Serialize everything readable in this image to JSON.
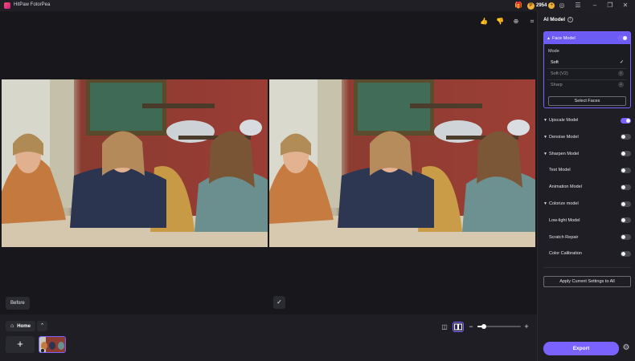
{
  "app": {
    "title": "HitPaw FotorPea"
  },
  "titlebar": {
    "credits": "2954",
    "icons": [
      "gift-icon",
      "coin-icon",
      "plus-icon",
      "user-icon",
      "menu-icon",
      "minimize-icon",
      "restore-icon",
      "close-icon"
    ]
  },
  "canvas": {
    "before_label": "Before",
    "preview_tools": [
      "thumbs-up-icon",
      "thumbs-down-icon",
      "zoom-icon",
      "crop-icon"
    ]
  },
  "bottom": {
    "home_label": "Home",
    "add_symbol": "+",
    "zoom_level": 0.15
  },
  "panel": {
    "title": "AI Model",
    "face_model": {
      "label": "Face Model",
      "enabled": true,
      "mode_label": "Mode",
      "modes": [
        {
          "name": "Soft",
          "selected": true
        },
        {
          "name": "Soft (V2)",
          "selected": false
        },
        {
          "name": "Sharp",
          "selected": false
        }
      ],
      "select_faces_label": "Select Faces"
    },
    "models": [
      {
        "name": "Upscale Model",
        "expandable": true,
        "enabled": true
      },
      {
        "name": "Denoise Model",
        "expandable": true,
        "enabled": false
      },
      {
        "name": "Sharpen Model",
        "expandable": true,
        "enabled": false
      },
      {
        "name": "Text Model",
        "expandable": false,
        "enabled": false
      },
      {
        "name": "Animation Model",
        "expandable": false,
        "enabled": false
      },
      {
        "name": "Colorize model",
        "expandable": true,
        "enabled": false
      },
      {
        "name": "Low-light Model",
        "expandable": false,
        "enabled": false
      },
      {
        "name": "Scratch Repair",
        "expandable": false,
        "enabled": false
      },
      {
        "name": "Color Calibration",
        "expandable": false,
        "enabled": false
      }
    ],
    "apply_label": "Apply Current Settings to All",
    "export_label": "Export"
  },
  "colors": {
    "accent": "#7a62ff",
    "panel_bg": "#1e1e24",
    "app_bg": "#17171c"
  }
}
